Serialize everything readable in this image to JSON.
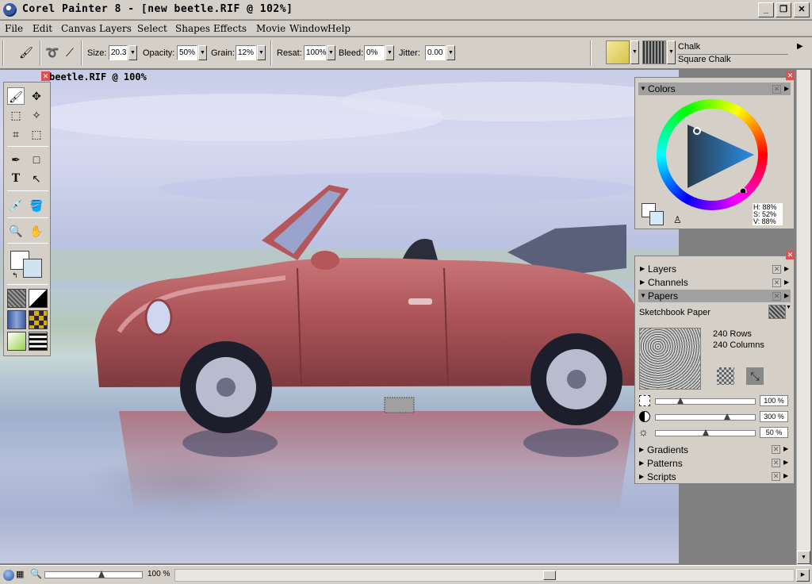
{
  "window": {
    "title": "Corel Painter 8 - [new beetle.RIF @ 102%]"
  },
  "menu": [
    "File",
    "Edit",
    "Canvas",
    "Layers",
    "Select",
    "Shapes",
    "Effects",
    "Movie",
    "Window",
    "Help"
  ],
  "property_bar": {
    "size_label": "Size:",
    "size_value": "20.3",
    "opacity_label": "Opacity:",
    "opacity_value": "50%",
    "grain_label": "Grain:",
    "grain_value": "12%",
    "resat_label": "Resat:",
    "resat_value": "100%",
    "bleed_label": "Bleed:",
    "bleed_value": "0%",
    "jitter_label": "Jitter:",
    "jitter_value": "0.00",
    "brush_category": "Chalk",
    "brush_variant": "Square Chalk"
  },
  "document": {
    "title": "beetle.RIF @ 100%"
  },
  "colors_panel": {
    "title": "Colors",
    "h": "H: 88%",
    "s": "S: 52%",
    "v": "V: 88%"
  },
  "panels": {
    "layers": "Layers",
    "channels": "Channels",
    "papers": "Papers",
    "paper_name": "Sketchbook Paper",
    "rows": "240 Rows",
    "columns": "240 Columns",
    "scale_pct": "100 %",
    "contrast_pct": "300 %",
    "brightness_pct": "50 %",
    "scale_fraction": 0.25,
    "contrast_fraction": 0.72,
    "brightness_fraction": 0.5,
    "gradients": "Gradients",
    "patterns": "Patterns",
    "scripts": "Scripts"
  },
  "status": {
    "zoom": "100 %",
    "zoom_fraction": 0.58
  },
  "colors": {
    "chrome": "#d4d0c8",
    "car_body": "#b05a5e",
    "highlight": "#0a246a"
  }
}
